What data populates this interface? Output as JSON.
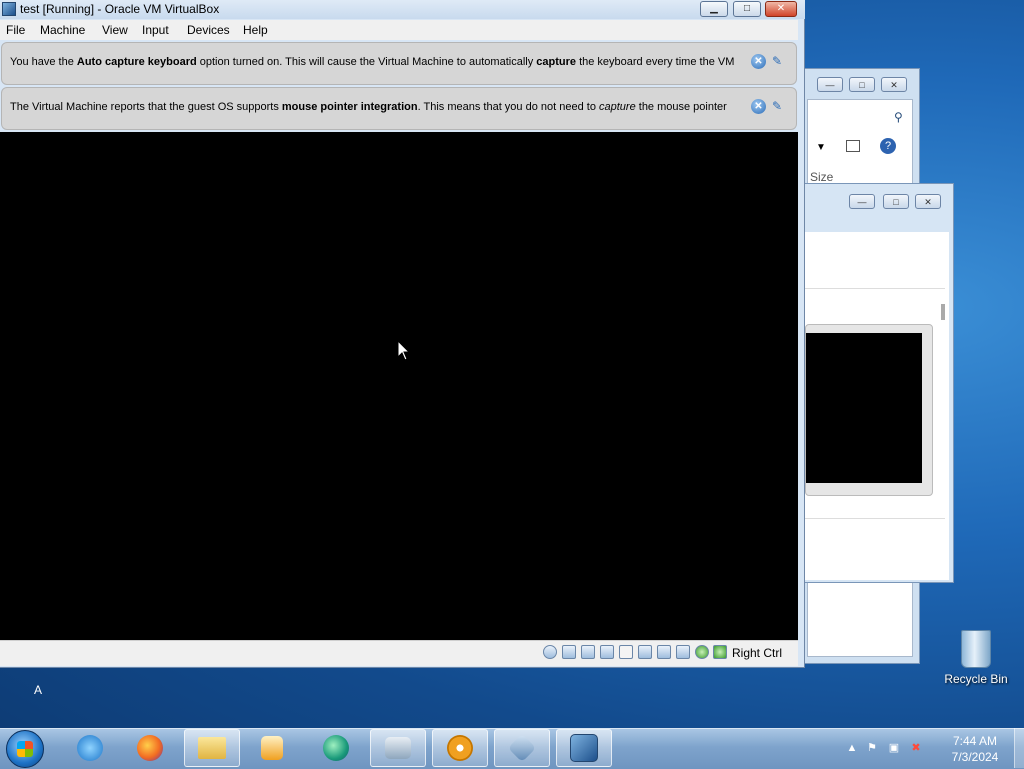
{
  "vbox": {
    "title": "test [Running] - Oracle VM VirtualBox",
    "menu": [
      "File",
      "Machine",
      "View",
      "Input",
      "Devices",
      "Help"
    ],
    "notice1": {
      "pre": "You have the ",
      "b1": "Auto capture keyboard",
      "mid": " option turned on. This will cause the Virtual Machine to automatically ",
      "b2": "capture",
      "post": " the keyboard every time the VM"
    },
    "notice2": {
      "pre": "The Virtual Machine reports that the guest OS supports ",
      "b1": "mouse pointer integration",
      "mid": ". This means that you do not need to ",
      "i1": "capture",
      "post": " the mouse pointer"
    },
    "host_key": "Right Ctrl"
  },
  "bg_window": {
    "column_header": "Size"
  },
  "desktop": {
    "recycle_bin": "Recycle Bin",
    "letter": "A"
  },
  "taskbar": {
    "time": "7:44 AM",
    "date": "7/3/2024",
    "apps": [
      "internet-explorer",
      "firefox",
      "file-explorer",
      "media-player",
      "edge-green",
      "system-tool",
      "optical-disc",
      "virtualbox",
      "vista-vm"
    ]
  }
}
